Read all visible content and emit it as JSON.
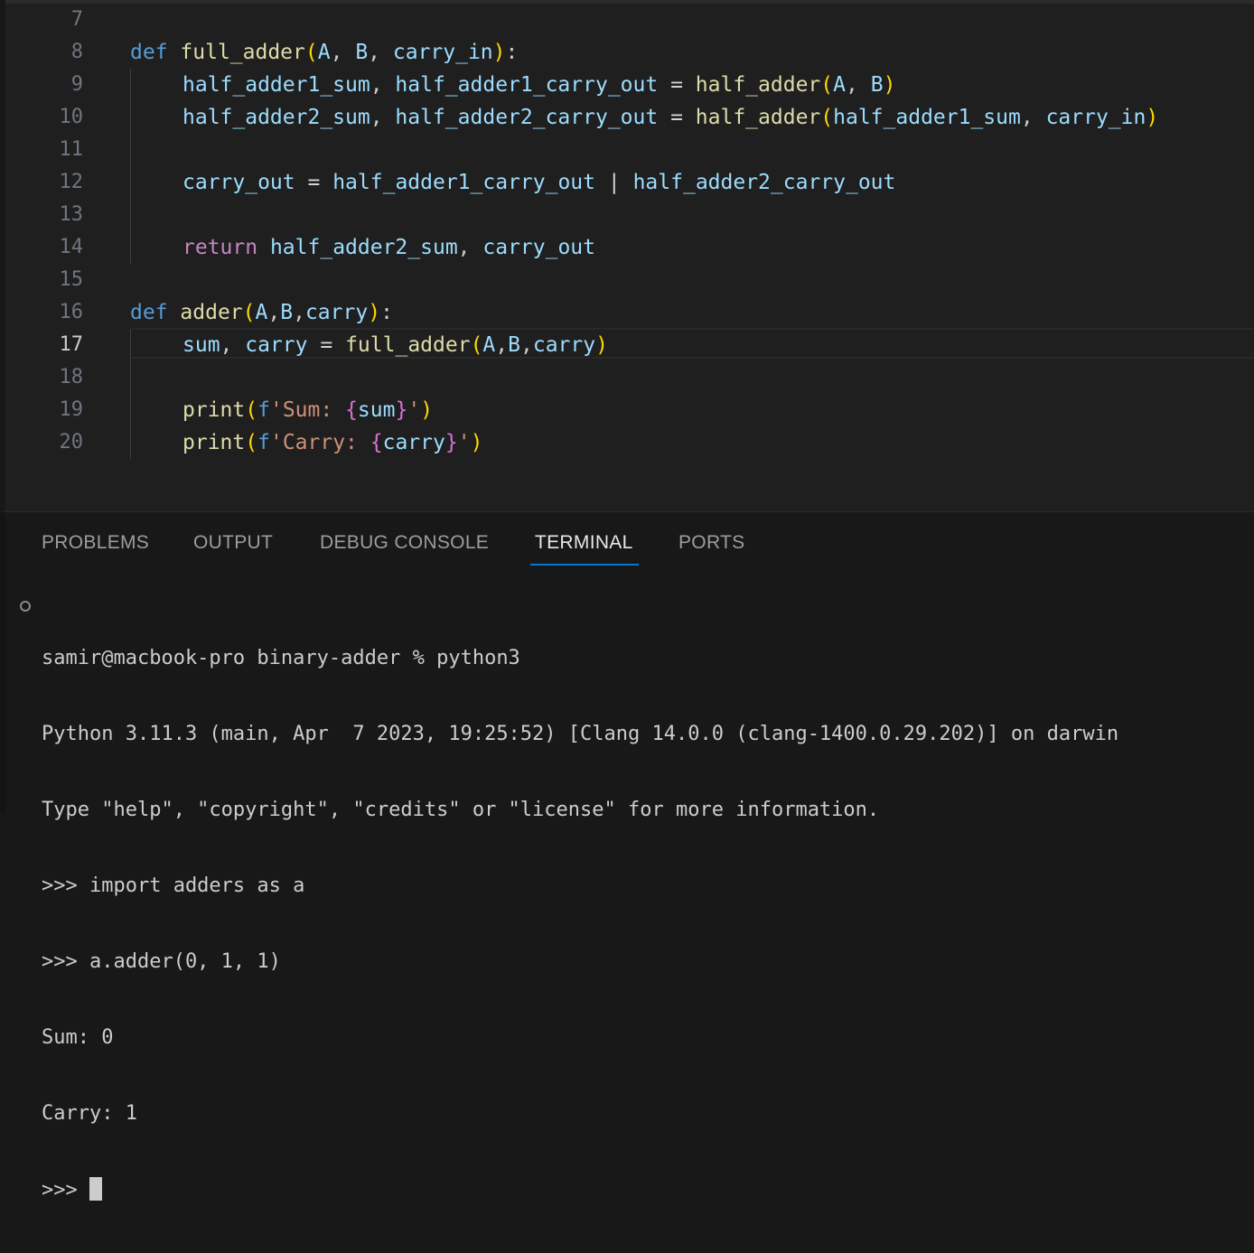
{
  "editor": {
    "lines": [
      {
        "n": "7"
      },
      {
        "n": "8"
      },
      {
        "n": "9"
      },
      {
        "n": "10"
      },
      {
        "n": "11"
      },
      {
        "n": "12"
      },
      {
        "n": "13"
      },
      {
        "n": "14"
      },
      {
        "n": "15"
      },
      {
        "n": "16"
      },
      {
        "n": "17"
      },
      {
        "n": "18"
      },
      {
        "n": "19"
      },
      {
        "n": "20"
      }
    ],
    "active_line": "17",
    "tokens": {
      "def": "def",
      "full_adder": "full_adder",
      "A": "A",
      "B": "B",
      "carry_in": "carry_in",
      "half_adder1_sum": "half_adder1_sum",
      "half_adder1_carry_out": "half_adder1_carry_out",
      "half_adder2_sum": "half_adder2_sum",
      "half_adder2_carry_out": "half_adder2_carry_out",
      "half_adder": "half_adder",
      "carry_out": "carry_out",
      "return": "return",
      "adder": "adder",
      "carry": "carry",
      "sum": "sum",
      "print": "print",
      "f": "f",
      "str_sum": "'Sum: ",
      "str_carry": "'Carry: ",
      "quote": "'"
    }
  },
  "panel": {
    "tabs": [
      {
        "label": "PROBLEMS"
      },
      {
        "label": "OUTPUT"
      },
      {
        "label": "DEBUG CONSOLE"
      },
      {
        "label": "TERMINAL"
      },
      {
        "label": "PORTS"
      }
    ],
    "active_tab": "TERMINAL",
    "terminal": [
      "samir@macbook-pro binary-adder % python3",
      "Python 3.11.3 (main, Apr  7 2023, 19:25:52) [Clang 14.0.0 (clang-1400.0.29.202)] on darwin",
      "Type \"help\", \"copyright\", \"credits\" or \"license\" for more information.",
      ">>> import adders as a",
      ">>> a.adder(0, 1, 1)",
      "Sum: 0",
      "Carry: 1",
      ">>> "
    ]
  },
  "colors": {
    "keyword": "#569cd6",
    "control": "#c586c0",
    "function": "#dcdcaa",
    "variable": "#9cdcfe",
    "string": "#ce9178",
    "bracket1": "#ffd700",
    "bracket2": "#da70d6",
    "active_tab_underline": "#0078d4"
  }
}
